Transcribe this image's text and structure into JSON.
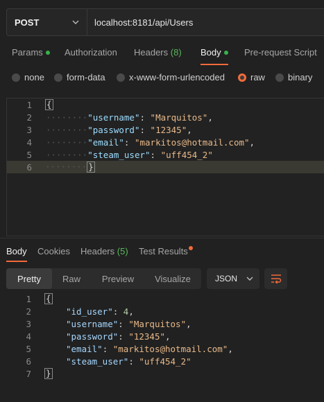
{
  "request": {
    "method": "POST",
    "url": "localhost:8181/api/Users"
  },
  "request_tabs": {
    "params": "Params",
    "authorization": "Authorization",
    "headers": "Headers",
    "headers_count": "(8)",
    "body": "Body",
    "pre_request": "Pre-request Script"
  },
  "body_types": {
    "none": "none",
    "form_data": "form-data",
    "urlencoded": "x-www-form-urlencoded",
    "raw": "raw",
    "binary": "binary",
    "selected": "raw"
  },
  "request_body": {
    "line_numbers": [
      "1",
      "2",
      "3",
      "4",
      "5",
      "6"
    ],
    "open": "{",
    "close": "}",
    "fields": [
      {
        "key": "\"username\"",
        "value": "\"Marquitos\"",
        "comma": ","
      },
      {
        "key": "\"password\"",
        "value": "\"12345\"",
        "comma": ","
      },
      {
        "key": "\"email\"",
        "value": "\"markitos@hotmail.com\"",
        "comma": ","
      },
      {
        "key": "\"steam_user\"",
        "value": "\"uff454_2\"",
        "comma": ""
      }
    ]
  },
  "response_tabs": {
    "body": "Body",
    "cookies": "Cookies",
    "headers": "Headers",
    "headers_count": "(5)",
    "test_results": "Test Results"
  },
  "view_modes": {
    "pretty": "Pretty",
    "raw": "Raw",
    "preview": "Preview",
    "visualize": "Visualize",
    "format": "JSON"
  },
  "response_body": {
    "line_numbers": [
      "1",
      "2",
      "3",
      "4",
      "5",
      "6",
      "7"
    ],
    "open": "{",
    "close": "}",
    "fields": [
      {
        "key": "\"id_user\"",
        "value": "4",
        "comma": ","
      },
      {
        "key": "\"username\"",
        "value": "\"Marquitos\"",
        "comma": ","
      },
      {
        "key": "\"password\"",
        "value": "\"12345\"",
        "comma": ","
      },
      {
        "key": "\"email\"",
        "value": "\"markitos@hotmail.com\"",
        "comma": ","
      },
      {
        "key": "\"steam_user\"",
        "value": "\"uff454_2\"",
        "comma": ""
      }
    ]
  },
  "colors": {
    "accent": "#f26b3a",
    "active_dot": "#38b24c"
  }
}
